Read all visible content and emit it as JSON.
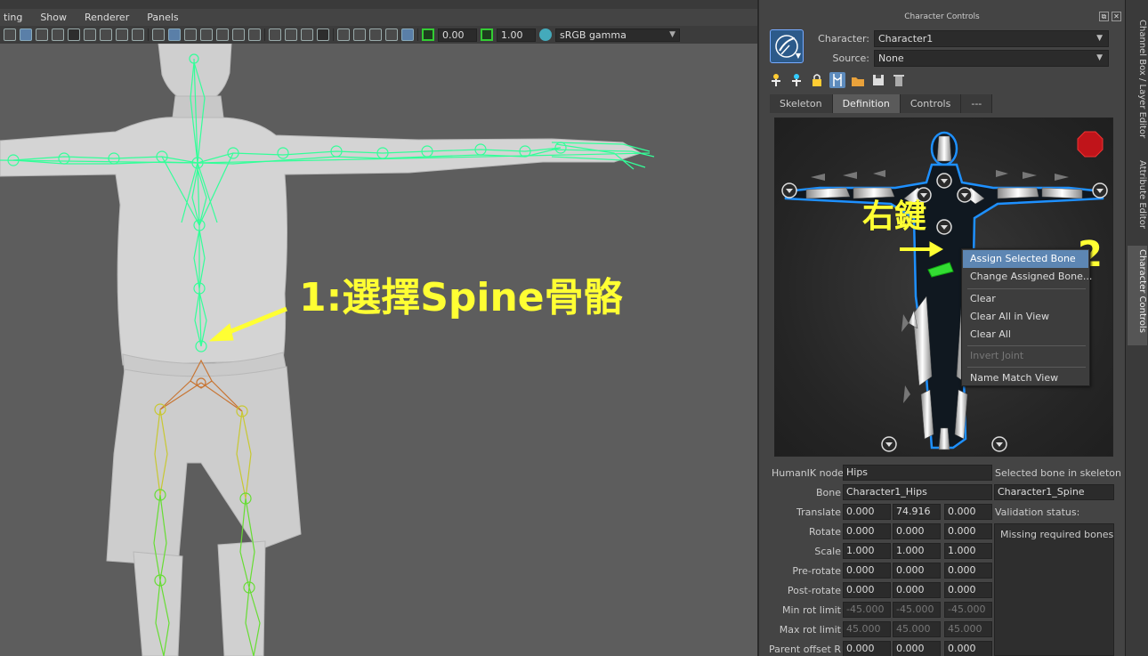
{
  "menubar": [
    "ting",
    "Show",
    "Renderer",
    "Panels"
  ],
  "viewport_toolbar": {
    "exposure_value": "0.00",
    "gamma_value": "1.00",
    "color_space": "sRGB gamma"
  },
  "annotations": {
    "step1": "1:選擇Spine骨骼",
    "right_click": "右鍵",
    "step2": "2"
  },
  "panel": {
    "title": "Character Controls",
    "character_label": "Character:",
    "character_value": "Character1",
    "source_label": "Source:",
    "source_value": "None",
    "tabs": [
      "Skeleton",
      "Definition",
      "Controls",
      "---"
    ],
    "active_tab": "Definition"
  },
  "context_menu": {
    "items": [
      {
        "label": "Assign Selected Bone",
        "state": "highlight"
      },
      {
        "label": "Change Assigned Bone...",
        "state": "normal"
      },
      {
        "label": "Clear",
        "state": "normal"
      },
      {
        "label": "Clear All in View",
        "state": "normal"
      },
      {
        "label": "Clear All",
        "state": "normal"
      },
      {
        "label": "Invert Joint",
        "state": "disabled"
      },
      {
        "label": "Name Match View",
        "state": "normal"
      }
    ]
  },
  "properties": {
    "humanik_node_label": "HumanIK node",
    "humanik_node_value": "Hips",
    "bone_label": "Bone",
    "bone_value": "Character1_Hips",
    "rows": [
      {
        "label": "Translate",
        "values": [
          "0.000",
          "74.916",
          "0.000"
        ],
        "dim": false
      },
      {
        "label": "Rotate",
        "values": [
          "0.000",
          "0.000",
          "0.000"
        ],
        "dim": false
      },
      {
        "label": "Scale",
        "values": [
          "1.000",
          "1.000",
          "1.000"
        ],
        "dim": false
      },
      {
        "label": "Pre-rotate",
        "values": [
          "0.000",
          "0.000",
          "0.000"
        ],
        "dim": false
      },
      {
        "label": "Post-rotate",
        "values": [
          "0.000",
          "0.000",
          "0.000"
        ],
        "dim": false
      },
      {
        "label": "Min rot limit",
        "values": [
          "-45.000",
          "-45.000",
          "-45.000"
        ],
        "dim": true
      },
      {
        "label": "Max rot limit",
        "values": [
          "45.000",
          "45.000",
          "45.000"
        ],
        "dim": true
      },
      {
        "label": "Parent offset R",
        "values": [
          "0.000",
          "0.000",
          "0.000"
        ],
        "dim": false
      }
    ],
    "selected_bone_label": "Selected bone in skeleton",
    "selected_bone_value": "Character1_Spine",
    "validation_label": "Validation status:",
    "validation_message": "Missing required bones."
  },
  "side_tabs": [
    "Channel Box / Layer Editor",
    "Attribute Editor",
    "Character Controls"
  ],
  "colors": {
    "joint_green": "#33ff99",
    "hip_orange": "#c87533",
    "leg_yellow": "#c8c832",
    "annotation_yellow": "#ffff33",
    "menu_highlight": "#5d86b3",
    "figure_blue": "#1e90ff"
  }
}
